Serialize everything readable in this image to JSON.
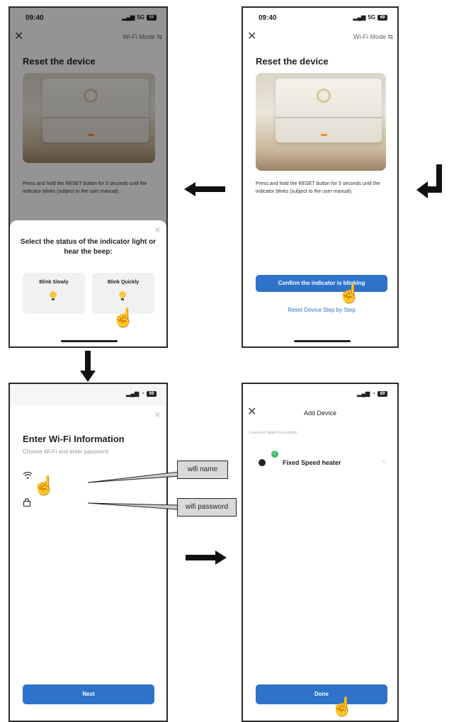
{
  "screen1": {
    "time": "09:40",
    "signal": "5G",
    "battery": "69",
    "close_icon": "close-icon",
    "mode": "Wi-Fi Mode ⇆",
    "title": "Reset the device",
    "instruction": "Press and hold the RESET button for 5 seconds until the indicator blinks (subject to the user manual).",
    "sheet_title": "Select the status of the indicator light or hear the beep:",
    "option_slow": "Blink Slowly",
    "option_quick": "Blink Quickly"
  },
  "screen2": {
    "time": "09:40",
    "signal": "5G",
    "battery": "69",
    "mode": "Wi-Fi Mode ⇆",
    "title": "Reset the device",
    "instruction": "Press and hold the RESET button for 5 seconds until the indicator blinks (subject to the user manual).",
    "confirm_button": "Confirm the indicator is blinking",
    "reset_link": "Reset Device Step by Step"
  },
  "screen3": {
    "battery": "69",
    "title": "Enter Wi-Fi Information",
    "subtitle": "Choose Wi-Fi and enter password",
    "wifi_icon": "wifi-icon",
    "lock_icon": "lock-icon",
    "next_button": "Next"
  },
  "screen4": {
    "battery": "69",
    "title": "Add Device",
    "added_text": "1 device(s) added successfully",
    "device_name": "Fixed Speed heater",
    "done_button": "Done"
  },
  "callouts": {
    "wifi_name": "wifi name",
    "wifi_password": "wifi password"
  },
  "colors": {
    "accent": "#2e73c9",
    "overlay": "#6b6b6b",
    "success": "#3cbf6a",
    "bulb": "#f6c945"
  }
}
